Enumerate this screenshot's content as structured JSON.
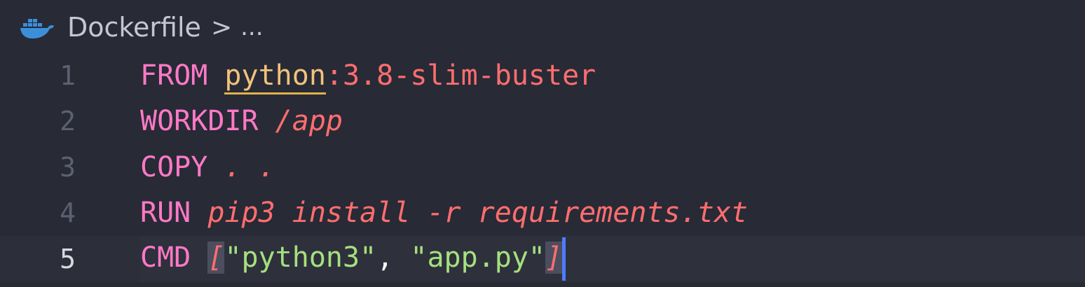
{
  "breadcrumb": {
    "file": "Dockerfile",
    "separator": ">",
    "more": "..."
  },
  "icons": {
    "file_icon": "docker-whale-icon"
  },
  "colors": {
    "background": "#282a36",
    "keyword": "#ff79c6",
    "string": "#a5e07e",
    "argument": "#ff6e6e",
    "image_name": "#f1c27a",
    "cursor": "#4d7cff"
  },
  "lines": [
    {
      "number": "1",
      "keyword": "FROM",
      "image": "python",
      "tag": ":3.8-slim-buster"
    },
    {
      "number": "2",
      "keyword": "WORKDIR",
      "arg": "/app"
    },
    {
      "number": "3",
      "keyword": "COPY",
      "arg": ". ."
    },
    {
      "number": "4",
      "keyword": "RUN",
      "arg": "pip3 install -r requirements.txt"
    },
    {
      "number": "5",
      "keyword": "CMD",
      "open_bracket": "[",
      "str1": "\"python3\"",
      "comma": ", ",
      "str2": "\"app.py\"",
      "close_bracket": "]"
    }
  ]
}
